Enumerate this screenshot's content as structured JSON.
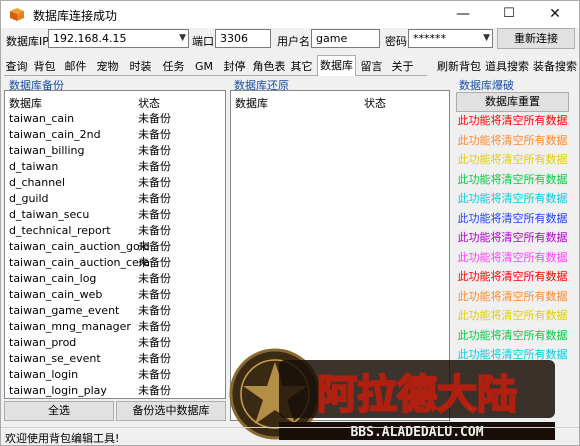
{
  "window": {
    "title": "数据库连接成功",
    "controls": {
      "minimize": "—",
      "maximize": "☐",
      "close": "✕"
    }
  },
  "connection": {
    "ip_label": "数据库IP",
    "ip_value": "192.168.4.15",
    "port_label": "端口",
    "port_value": "3306",
    "user_label": "用户名",
    "user_value": "game",
    "password_label": "密码",
    "password_value": "******",
    "reconnect_label": "重新连接"
  },
  "tabs": [
    "查询",
    "背包",
    "邮件",
    "宠物",
    "时装",
    "任务",
    "GM",
    "封停",
    "角色表",
    "其它",
    "数据库",
    "留言",
    "关于"
  ],
  "active_tab": "数据库",
  "tools": {
    "refresh_bag": "刷新背包",
    "item_search": "道具搜索",
    "equip_search": "装备搜索"
  },
  "backup": {
    "title": "数据库备份",
    "col_db": "数据库",
    "col_status": "状态",
    "rows": [
      {
        "name": "taiwan_cain",
        "status": "未备份"
      },
      {
        "name": "taiwan_cain_2nd",
        "status": "未备份"
      },
      {
        "name": "taiwan_billing",
        "status": "未备份"
      },
      {
        "name": "d_taiwan",
        "status": "未备份"
      },
      {
        "name": "d_channel",
        "status": "未备份"
      },
      {
        "name": "d_guild",
        "status": "未备份"
      },
      {
        "name": "d_taiwan_secu",
        "status": "未备份"
      },
      {
        "name": "d_technical_report",
        "status": "未备份"
      },
      {
        "name": "taiwan_cain_auction_gold",
        "status": "未备份"
      },
      {
        "name": "taiwan_cain_auction_cera",
        "status": "未备份"
      },
      {
        "name": "taiwan_cain_log",
        "status": "未备份"
      },
      {
        "name": "taiwan_cain_web",
        "status": "未备份"
      },
      {
        "name": "taiwan_game_event",
        "status": "未备份"
      },
      {
        "name": "taiwan_mng_manager",
        "status": "未备份"
      },
      {
        "name": "taiwan_prod",
        "status": "未备份"
      },
      {
        "name": "taiwan_se_event",
        "status": "未备份"
      },
      {
        "name": "taiwan_login",
        "status": "未备份"
      },
      {
        "name": "taiwan_login_play",
        "status": "未备份"
      }
    ],
    "select_all": "全选",
    "backup_selected": "备份选中数据库"
  },
  "restore": {
    "title": "数据库还原",
    "col_db": "数据库",
    "col_status": "状态"
  },
  "blast": {
    "title": "数据库爆破",
    "reset_label": "数据库重置",
    "warning_text": "此功能将清空所有数据",
    "line_colors": [
      "#ff0000",
      "#ff8a2a",
      "#e0d000",
      "#00cc44",
      "#00d0e0",
      "#2040ff",
      "#b000d0",
      "#ff40ff",
      "#ff0000",
      "#ff8a2a",
      "#e0d000",
      "#00cc44",
      "#00d0e0"
    ]
  },
  "logo": {
    "title": "阿拉德大陆",
    "url": "BBS.ALADEDALU.COM"
  },
  "status_bar": {
    "text": "欢迎使用背包编辑工具!"
  }
}
